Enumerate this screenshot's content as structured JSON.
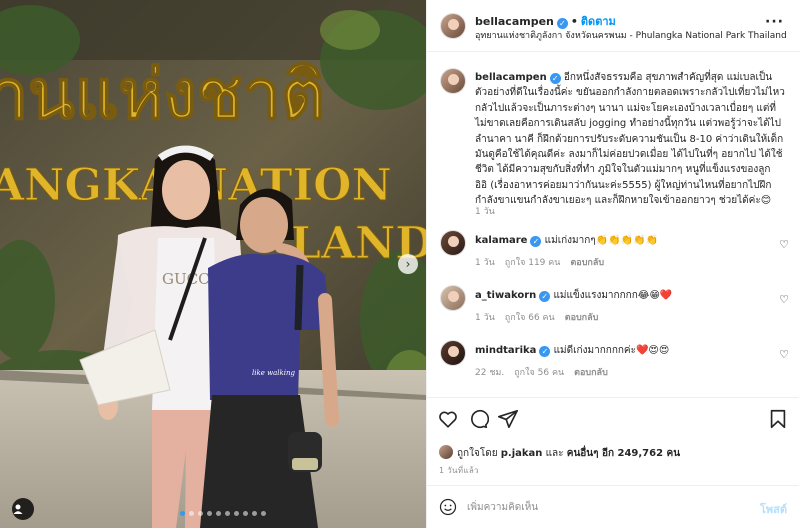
{
  "header": {
    "username": "bellacampen",
    "separator": "•",
    "follow_label": "ติดตาม",
    "location": "อุทยานแห่งชาติภูลังกา จังหวัดนครพนม - Phulangka National Park Thailand",
    "more_icon": "more-horizontal-icon"
  },
  "photo": {
    "sign_thai": "านแห่งชาติ",
    "sign_en_1": "ANGKA NATION",
    "sign_en_2": "LAND",
    "shirt_text": "GUCCI",
    "tshirt_text": "like walking",
    "next_icon": "›",
    "tag_icon": "person-tag-icon",
    "dots_count": 10,
    "active_dot": 0
  },
  "caption": {
    "username": "bellacampen",
    "text": "อีกหนึ่งสัจธรรมคือ สุขภาพสำคัญที่สุด แม่เบลเป็นตัวอย่างที่ดีในเรื่องนี้ค่ะ ขยันออกกำลังกายตลอดเพราะกลัวไปเที่ยวไม่ไหว กลัวไปแล้วจะเป็นภาระต่างๆ นานา แม่จะโยคะเองบ้างเวลาเบื่อยๆ แต่ที่ไม่ขาดเลยคือการเดินสลับ jogging ทำอย่างนี้ทุกวัน แต่วพอรู้ว่าจะได้ไปลำนาคา นาคี ก็ฝึกด้วยการปรับระดับความชันเป็น 8-10 ค่าว่าเดินให้เด็กมันดูคือใช้ได้คุณดีค่ะ ลงมาก็ไม่ค่อยปวดเมื่อย ได้ไปในที่ๆ อยากไป ได้ใช้ชีวิต ได้มีความสุขกับสิ่งที่ทำ ภูมิใจในตัวแม่มากๆ หนูที่แข็งแรงของลูก อิอิ (เรื่องอาหารค่อยมาว่ากันนะค่ะ5555) ผู้ใหญ่ท่านไหนที่อยากไปฝึกกำลังขาแขนกำลังขาเยอะๆ และก็ฝึกหายใจเข้าออกยาวๆ ช่วยได้ค่ะ😊",
    "time": "1 วัน"
  },
  "comments": [
    {
      "username": "kalamare",
      "text": "แม่เก่งมากๆ👏👏👏👏👏",
      "time": "1 วัน",
      "likes": "ถูกใจ 119 คน",
      "reply": "ตอบกลับ"
    },
    {
      "username": "a_tiwakorn",
      "text": "แม่แข็งแรงมากกกก😂😁❤️",
      "time": "1 วัน",
      "likes": "ถูกใจ 66 คน",
      "reply": "ตอบกลับ"
    },
    {
      "username": "mindtarika",
      "text": "แม่ดีเก่งมากกกกค่ะ❤️😍😍",
      "time": "22 ชม.",
      "likes": "ถูกใจ 56 คน",
      "reply": "ตอบกลับ"
    }
  ],
  "actions": {
    "like_icon": "heart-icon",
    "comment_icon": "comment-icon",
    "share_icon": "send-icon",
    "save_icon": "bookmark-icon"
  },
  "likes": {
    "prefix": "ถูกใจโดย",
    "first_user": "p.jakan",
    "joiner": "และ",
    "others": "คนอื่นๆ อีก 249,762 คน"
  },
  "post_time": "1 วันที่แล้ว",
  "add_comment": {
    "placeholder": "เพิ่มความคิดเห็น",
    "post_label": "โพสต์",
    "emoji_icon": "smiley-icon"
  }
}
